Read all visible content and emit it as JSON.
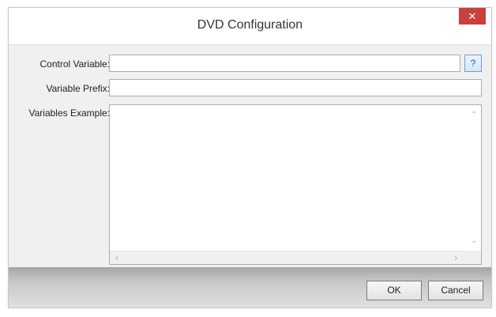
{
  "window": {
    "title": "DVD Configuration",
    "close_glyph": "✕"
  },
  "form": {
    "control_variable": {
      "label": "Control Variable:",
      "value": ""
    },
    "help_button": "?",
    "variable_prefix": {
      "label": "Variable Prefix:",
      "value": ""
    },
    "variables_example": {
      "label": "Variables Example:",
      "value": ""
    }
  },
  "scroll": {
    "up": "⌃",
    "down": "⌄",
    "left": "‹",
    "right": "›"
  },
  "buttons": {
    "ok": "OK",
    "cancel": "Cancel"
  },
  "colors": {
    "close_button": "#c8413b",
    "help_border": "#6d9fd1"
  }
}
